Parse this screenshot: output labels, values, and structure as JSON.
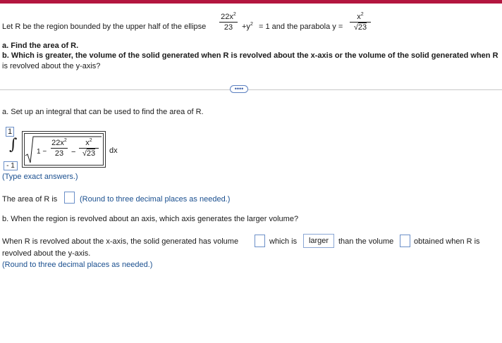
{
  "colors": {
    "accent": "#b3163f",
    "answer_blue": "#1a4f8f",
    "input_border": "#6b8fc8"
  },
  "intro": {
    "prefix": "Let R be the region bounded by the upper half of the ellipse",
    "ellipse_num": "22x",
    "ellipse_num_exp": "2",
    "ellipse_den": "23",
    "ellipse_rest": "+y",
    "ellipse_rest_exp": "2",
    "ellipse_end": "= 1 and the parabola y =",
    "parab_num": "x",
    "parab_num_exp": "2",
    "parab_den": "23"
  },
  "parts": {
    "a": "a. Find the area of R.",
    "b": "b. Which is greater, the volume of the solid generated when R is revolved about the x-axis or the volume of the solid generated when R",
    "b2": "is revolved about the y-axis?"
  },
  "more_button_label": "••••",
  "setup": {
    "heading": "a. Set up an integral that can be used to find the area of R.",
    "upper_limit": "1",
    "lower_limit": "- 1",
    "integrand_one": "1 −",
    "integrand_num1": "22x",
    "integrand_num1_exp": "2",
    "integrand_den1": "23",
    "integrand_minus": "−",
    "integrand_num2": "x",
    "integrand_num2_exp": "2",
    "integrand_den2": "23",
    "dx": "dx",
    "hint": "(Type exact answers.)"
  },
  "area_line": {
    "prefix": "The area of R is",
    "value": "",
    "note": "(Round to three decimal places as needed.)"
  },
  "part_b": {
    "question": "b. When the region is revolved about an axis, which axis generates the larger volume?",
    "sentence_1": "When R is revolved about the x-axis, the solid generated has volume",
    "volume_x_value": "",
    "which_is": "which is",
    "comparison_selected": "larger",
    "than_volume": "than the volume",
    "volume_y_value": "",
    "obtained": "obtained when R is",
    "sentence_2": "revolved about the y-axis.",
    "note": "(Round to three decimal places as needed.)"
  }
}
